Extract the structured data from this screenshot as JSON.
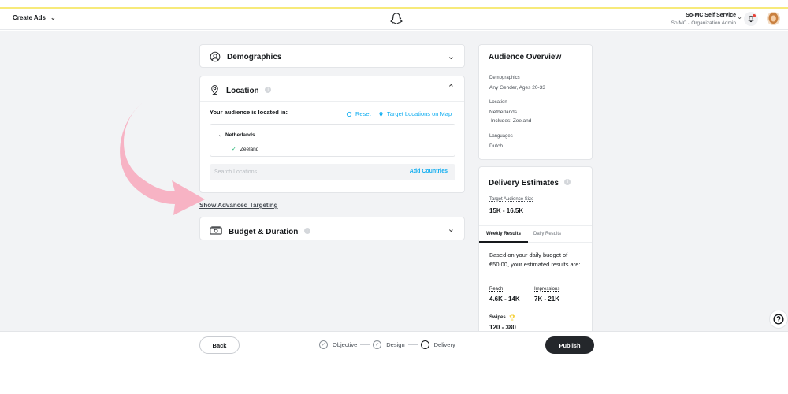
{
  "header": {
    "create_ads": "Create Ads",
    "account_name": "So-MC Self Service",
    "account_org": "So MC - Organization Admin"
  },
  "demographics": {
    "title": "Demographics"
  },
  "location": {
    "title": "Location",
    "audience_located": "Your audience is located in:",
    "reset": "Reset",
    "target_map": "Target Locations on Map",
    "country": "Netherlands",
    "region": "Zeeland",
    "search_placeholder": "Search Locations...",
    "add_countries": "Add Countries"
  },
  "advanced_targeting": "Show Advanced Targeting",
  "budget": {
    "title": "Budget & Duration"
  },
  "audience_overview": {
    "title": "Audience Overview",
    "demographics_label": "Demographics",
    "demographics_value": "Any Gender, Ages 20-33",
    "location_label": "Location",
    "location_value": "Netherlands",
    "location_includes": "Includes: Zeeland",
    "languages_label": "Languages",
    "languages_value": "Dutch"
  },
  "delivery": {
    "title": "Delivery Estimates",
    "tas_label": "Target Audience Size",
    "tas_value": "15K - 16.5K",
    "tab_weekly": "Weekly Results",
    "tab_daily": "Daily Results",
    "based_text": "Based on your daily budget of €50.00, your estimated results are:",
    "reach_label": "Reach",
    "reach_value": "4.6K - 14K",
    "impressions_label": "Impressions",
    "impressions_value": "7K - 21K",
    "swipes_label": "Swipes",
    "swipes_value": "120 - 380"
  },
  "footer": {
    "back": "Back",
    "step_objective": "Objective",
    "step_design": "Design",
    "step_delivery": "Delivery",
    "publish": "Publish"
  },
  "colors": {
    "accent_blue": "#0fadf0",
    "arrow_pink": "#f7b3c4",
    "publish_bg": "#24272b"
  }
}
